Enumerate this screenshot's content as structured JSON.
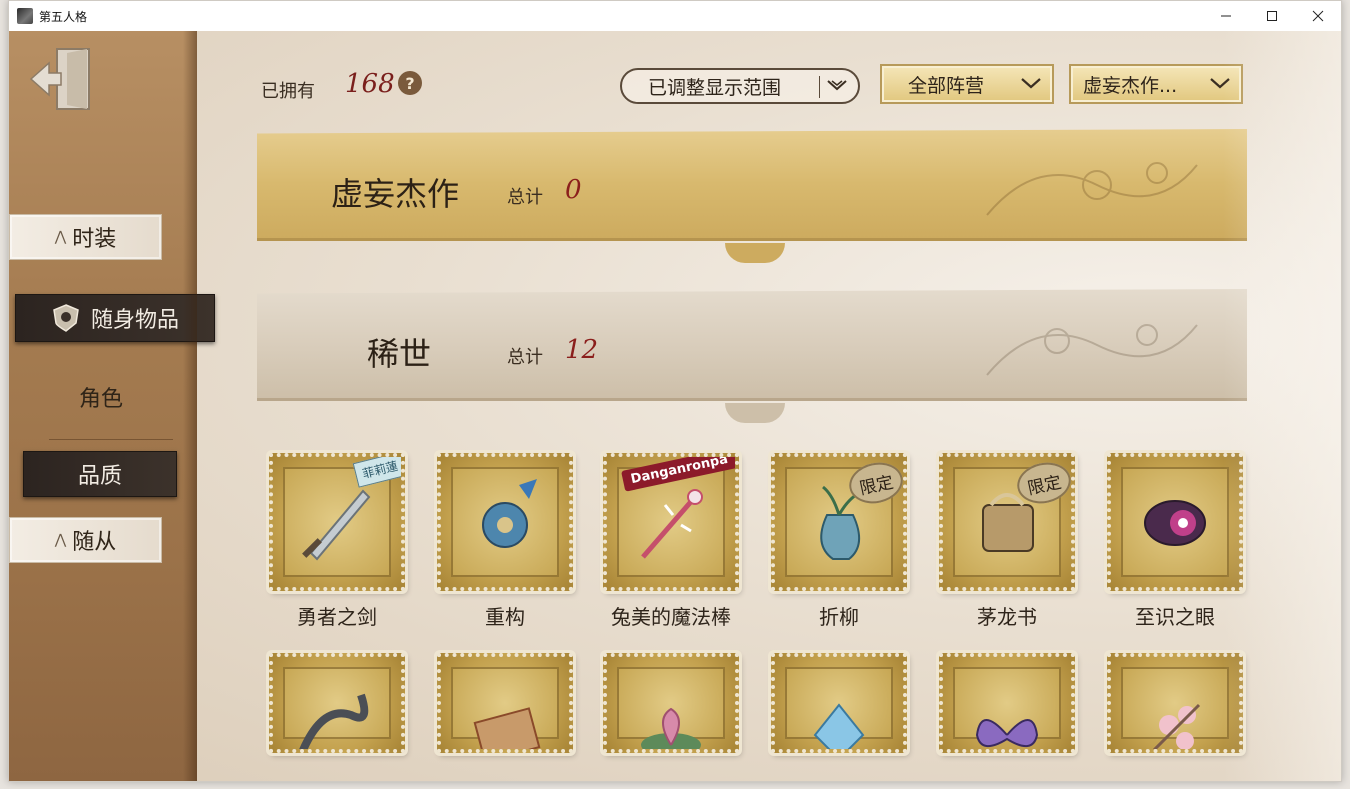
{
  "window": {
    "title": "第五人格"
  },
  "sidebar": {
    "items": [
      {
        "label": "时装"
      },
      {
        "label": "随身物品"
      },
      {
        "label": "角色"
      },
      {
        "label": "品质"
      },
      {
        "label": "随从"
      }
    ]
  },
  "header": {
    "owned_label": "已拥有",
    "owned_count": "168",
    "help_label": "?",
    "filter_range": "已调整显示范围",
    "filter_faction": "全部阵营",
    "filter_quality": "虚妄杰作..."
  },
  "categories": [
    {
      "title": "虚妄杰作",
      "total_label": "总计",
      "total": "0"
    },
    {
      "title": "稀世",
      "total_label": "总计",
      "total": "12"
    }
  ],
  "badges": {
    "limited": "限定",
    "tag": "菲莉蓮",
    "logo": "Danganronpa"
  },
  "items": [
    {
      "name": "勇者之剑",
      "icon": "sword-icon",
      "color": "#9aa6ad"
    },
    {
      "name": "重构",
      "icon": "flower-icon",
      "color": "#5a8fb3"
    },
    {
      "name": "兔美的魔法棒",
      "icon": "wand-icon",
      "color": "#c54f6b"
    },
    {
      "name": "折柳",
      "icon": "vase-icon",
      "color": "#6fa3b8"
    },
    {
      "name": "茅龙书",
      "icon": "book-icon",
      "color": "#d9c69a"
    },
    {
      "name": "至识之眼",
      "icon": "eye-icon",
      "color": "#7a3a7c"
    }
  ],
  "items_row2": [
    {
      "icon": "dragon-icon",
      "color": "#4a4e55"
    },
    {
      "icon": "scroll-icon",
      "color": "#8a4a2a"
    },
    {
      "icon": "lotus-icon",
      "color": "#c97aa0"
    },
    {
      "icon": "crystal-icon",
      "color": "#6ab2d8"
    },
    {
      "icon": "butterfly-icon",
      "color": "#6b4aa0"
    },
    {
      "icon": "blossom-icon",
      "color": "#e8a6b4"
    }
  ]
}
